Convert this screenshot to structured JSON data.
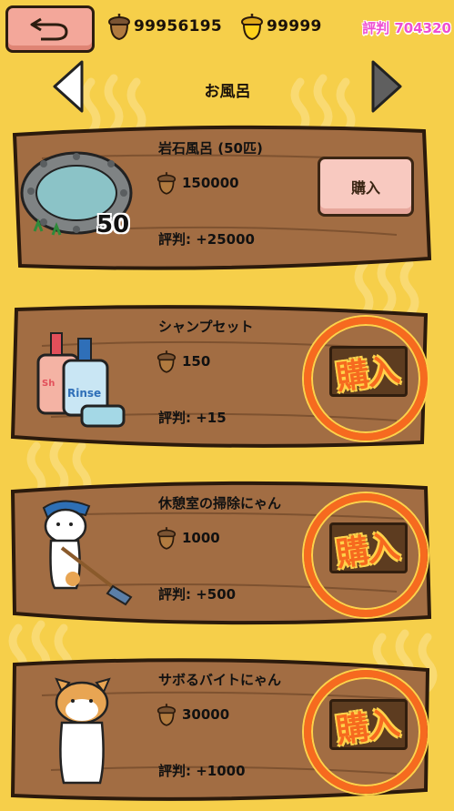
{
  "header": {
    "acorns_brown": "99956195",
    "acorns_gold": "99999",
    "reputation": "評判 704320",
    "category": "お風呂"
  },
  "items": [
    {
      "name": "岩石風呂 (50匹)",
      "price": "150000",
      "reputation": "評判: +25000",
      "capacity": "50",
      "buy_label": "購入",
      "sold_out": false
    },
    {
      "name": "シャンプセット",
      "price": "150",
      "reputation": "評判: +15",
      "bottle_label": "Rinse",
      "bottle_label_2": "Sh",
      "buy_label": "購入",
      "sold_out": true
    },
    {
      "name": "休憩室の掃除にゃん",
      "price": "1000",
      "reputation": "評判: +500",
      "buy_label": "購入",
      "sold_out": true
    },
    {
      "name": "サボるバイトにゃん",
      "price": "30000",
      "reputation": "評判: +1000",
      "buy_label": "購入",
      "sold_out": true
    }
  ],
  "colors": {
    "background": "#f6cf4a",
    "wood": "#a26d43",
    "stamp": "#f66a1f",
    "reputation_text": "#ee4fd2",
    "buy_button": "#f8c9c0"
  }
}
